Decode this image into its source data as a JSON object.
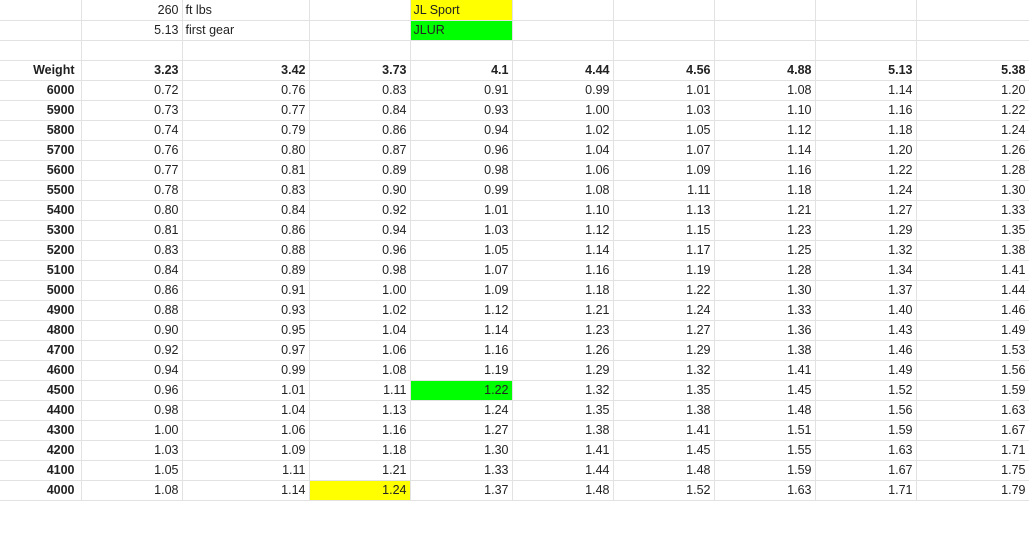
{
  "sheet": {
    "info": {
      "torque_value": "260",
      "torque_unit": "ft lbs",
      "gear_value": "5.13",
      "gear_label": "first gear",
      "legend_sport": "JL Sport",
      "legend_jlur": "JLUR"
    },
    "colors": {
      "yellow": "#ffff00",
      "green": "#00ff00",
      "gridline": "#e2e2e2"
    },
    "header": {
      "weight_label": "Weight",
      "ratios": [
        "3.23",
        "3.42",
        "3.73",
        "4.1",
        "4.44",
        "4.56",
        "4.88",
        "5.13",
        "5.38"
      ]
    },
    "rows": [
      {
        "weight": "6000",
        "values": [
          "0.72",
          "0.76",
          "0.83",
          "0.91",
          "0.99",
          "1.01",
          "1.08",
          "1.14",
          "1.20"
        ]
      },
      {
        "weight": "5900",
        "values": [
          "0.73",
          "0.77",
          "0.84",
          "0.93",
          "1.00",
          "1.03",
          "1.10",
          "1.16",
          "1.22"
        ]
      },
      {
        "weight": "5800",
        "values": [
          "0.74",
          "0.79",
          "0.86",
          "0.94",
          "1.02",
          "1.05",
          "1.12",
          "1.18",
          "1.24"
        ]
      },
      {
        "weight": "5700",
        "values": [
          "0.76",
          "0.80",
          "0.87",
          "0.96",
          "1.04",
          "1.07",
          "1.14",
          "1.20",
          "1.26"
        ]
      },
      {
        "weight": "5600",
        "values": [
          "0.77",
          "0.81",
          "0.89",
          "0.98",
          "1.06",
          "1.09",
          "1.16",
          "1.22",
          "1.28"
        ]
      },
      {
        "weight": "5500",
        "values": [
          "0.78",
          "0.83",
          "0.90",
          "0.99",
          "1.08",
          "1.11",
          "1.18",
          "1.24",
          "1.30"
        ]
      },
      {
        "weight": "5400",
        "values": [
          "0.80",
          "0.84",
          "0.92",
          "1.01",
          "1.10",
          "1.13",
          "1.21",
          "1.27",
          "1.33"
        ]
      },
      {
        "weight": "5300",
        "values": [
          "0.81",
          "0.86",
          "0.94",
          "1.03",
          "1.12",
          "1.15",
          "1.23",
          "1.29",
          "1.35"
        ]
      },
      {
        "weight": "5200",
        "values": [
          "0.83",
          "0.88",
          "0.96",
          "1.05",
          "1.14",
          "1.17",
          "1.25",
          "1.32",
          "1.38"
        ]
      },
      {
        "weight": "5100",
        "values": [
          "0.84",
          "0.89",
          "0.98",
          "1.07",
          "1.16",
          "1.19",
          "1.28",
          "1.34",
          "1.41"
        ]
      },
      {
        "weight": "5000",
        "values": [
          "0.86",
          "0.91",
          "1.00",
          "1.09",
          "1.18",
          "1.22",
          "1.30",
          "1.37",
          "1.44"
        ]
      },
      {
        "weight": "4900",
        "values": [
          "0.88",
          "0.93",
          "1.02",
          "1.12",
          "1.21",
          "1.24",
          "1.33",
          "1.40",
          "1.46"
        ]
      },
      {
        "weight": "4800",
        "values": [
          "0.90",
          "0.95",
          "1.04",
          "1.14",
          "1.23",
          "1.27",
          "1.36",
          "1.43",
          "1.49"
        ]
      },
      {
        "weight": "4700",
        "values": [
          "0.92",
          "0.97",
          "1.06",
          "1.16",
          "1.26",
          "1.29",
          "1.38",
          "1.46",
          "1.53"
        ]
      },
      {
        "weight": "4600",
        "values": [
          "0.94",
          "0.99",
          "1.08",
          "1.19",
          "1.29",
          "1.32",
          "1.41",
          "1.49",
          "1.56"
        ]
      },
      {
        "weight": "4500",
        "values": [
          "0.96",
          "1.01",
          "1.11",
          "1.22",
          "1.32",
          "1.35",
          "1.45",
          "1.52",
          "1.59"
        ]
      },
      {
        "weight": "4400",
        "values": [
          "0.98",
          "1.04",
          "1.13",
          "1.24",
          "1.35",
          "1.38",
          "1.48",
          "1.56",
          "1.63"
        ]
      },
      {
        "weight": "4300",
        "values": [
          "1.00",
          "1.06",
          "1.16",
          "1.27",
          "1.38",
          "1.41",
          "1.51",
          "1.59",
          "1.67"
        ]
      },
      {
        "weight": "4200",
        "values": [
          "1.03",
          "1.09",
          "1.18",
          "1.30",
          "1.41",
          "1.45",
          "1.55",
          "1.63",
          "1.71"
        ]
      },
      {
        "weight": "4100",
        "values": [
          "1.05",
          "1.11",
          "1.21",
          "1.33",
          "1.44",
          "1.48",
          "1.59",
          "1.67",
          "1.75"
        ]
      },
      {
        "weight": "4000",
        "values": [
          "1.08",
          "1.14",
          "1.24",
          "1.37",
          "1.48",
          "1.52",
          "1.63",
          "1.71",
          "1.79"
        ]
      }
    ],
    "highlights": [
      {
        "row": 15,
        "col": 3,
        "color": "green"
      },
      {
        "row": 20,
        "col": 2,
        "color": "yellow"
      }
    ]
  }
}
